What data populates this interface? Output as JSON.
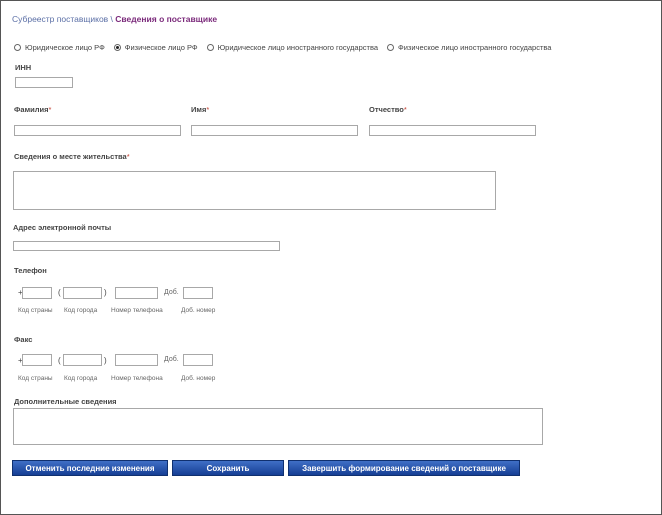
{
  "breadcrumb": {
    "parent": "Субреестр поставщиков",
    "separator": " \\ ",
    "current": "Сведения о поставщике"
  },
  "supplier_type": {
    "options": [
      {
        "label": "Юридическое лицо РФ",
        "selected": false
      },
      {
        "label": "Физическое лицо РФ",
        "selected": true
      },
      {
        "label": "Юридическое лицо иностранного государства",
        "selected": false
      },
      {
        "label": "Физическое лицо иностранного государства",
        "selected": false
      }
    ]
  },
  "form": {
    "inn_label": "ИНН",
    "inn_value": "",
    "surname_label": "Фамилия",
    "name_label": "Имя",
    "patronymic_label": "Отчество",
    "required_mark": "*",
    "residence_label": "Сведения о месте жительства",
    "email_label": "Адрес электронной почты",
    "phone_label": "Телефон",
    "fax_label": "Факс",
    "additional_label": "Дополнительные сведения",
    "plus": "+",
    "open_paren": "(",
    "close_paren": ")",
    "ext_short": "Доб.",
    "country_code_caption": "Код страны",
    "city_code_caption": "Код города",
    "number_caption": "Номер телефона",
    "ext_caption": "Доб. номер"
  },
  "buttons": {
    "revert": "Отменить последние изменения",
    "save": "Сохранить",
    "finish": "Завершить формирование сведений о поставщике"
  },
  "colors": {
    "button_top": "#3f6fc6",
    "button_bottom": "#153e94",
    "link": "#5b6fa6",
    "current": "#7b2a7b",
    "required": "#c0392b"
  }
}
